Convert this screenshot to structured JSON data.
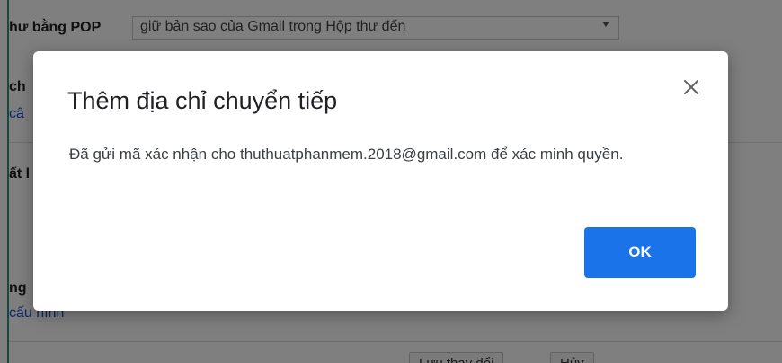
{
  "background": {
    "pop_label": "hư bằng POP",
    "pop_select_value": "giữ bản sao của Gmail trong Hộp thư đến",
    "fragment_ch": "ch",
    "fragment_ca": "câ",
    "fragment_at": "ất l",
    "fragment_ng": "ng",
    "fragment_cau_hinh": "cấu hình",
    "save_button_label": "Lưu thay đổi",
    "cancel_button_label": "Hủy"
  },
  "dialog": {
    "title": "Thêm địa chỉ chuyển tiếp",
    "body": "Đã gửi mã xác nhận cho thuthuatphanmem.2018@gmail.com để xác minh quyền.",
    "ok_label": "OK"
  },
  "colors": {
    "primary_button": "#1a73e8",
    "overlay": "rgba(0,0,0,0.5)",
    "link": "#1a4fd6"
  },
  "icons": {
    "close": "close-icon",
    "dropdown": "chevron-down-icon"
  }
}
